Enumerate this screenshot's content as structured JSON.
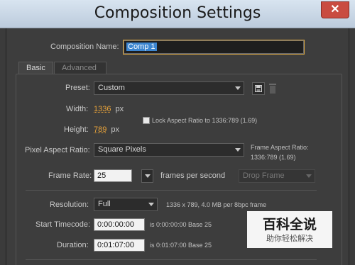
{
  "window": {
    "title": "Composition Settings",
    "close_icon": "close-icon"
  },
  "composition_name": {
    "label": "Composition Name:",
    "value": "Comp 1"
  },
  "tabs": [
    {
      "label": "Basic",
      "active": true
    },
    {
      "label": "Advanced",
      "active": false
    }
  ],
  "preset": {
    "label": "Preset:",
    "value": "Custom"
  },
  "width": {
    "label": "Width:",
    "value": "1336",
    "unit": "px"
  },
  "height": {
    "label": "Height:",
    "value": "789",
    "unit": "px"
  },
  "lock_aspect": {
    "label": "Lock Aspect Ratio to 1336:789 (1.69)",
    "checked": false
  },
  "pixel_aspect": {
    "label": "Pixel Aspect Ratio:",
    "value": "Square Pixels"
  },
  "frame_aspect": {
    "label": "Frame Aspect Ratio:",
    "value": "1336:789 (1.69)"
  },
  "frame_rate": {
    "label": "Frame Rate:",
    "value": "25",
    "unit": "frames per second",
    "drop_frame": "Drop Frame"
  },
  "resolution": {
    "label": "Resolution:",
    "value": "Full",
    "info": "1336 x 789, 4.0 MB per 8bpc frame"
  },
  "start_timecode": {
    "label": "Start Timecode:",
    "value": "0:00:00:00",
    "info": "is 0:00:00:00  Base 25"
  },
  "duration": {
    "label": "Duration:",
    "value": "0:01:07:00",
    "info": "is 0:01:07:00  Base 25"
  },
  "watermark": {
    "main": "百科全说",
    "sub": "助你轻松解决"
  },
  "colors": {
    "accent_orange": "#e8a33a",
    "selection_blue": "#3d86d0",
    "close_red": "#c94c41"
  }
}
